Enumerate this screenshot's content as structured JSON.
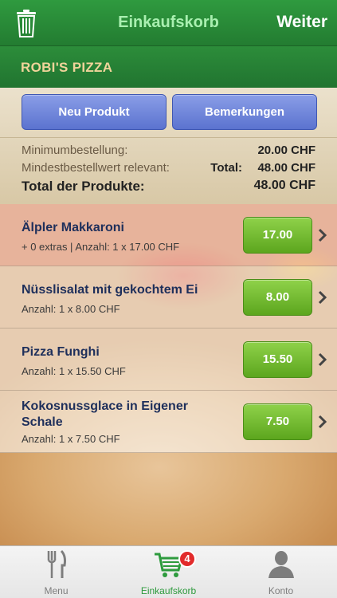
{
  "header": {
    "title": "Einkaufskorb",
    "right_action": "Weiter",
    "left_icon": "trash-icon"
  },
  "shop": {
    "name": "ROBI'S PIZZA"
  },
  "actions": {
    "new_product": "Neu Produkt",
    "remarks": "Bemerkungen"
  },
  "summary": {
    "min_order_label": "Minimumbestellung:",
    "min_order_value": "20.00 CHF",
    "min_relevant_label": "Mindestbestellwert relevant:",
    "total_label": "Total:",
    "total_value": "48.00 CHF",
    "products_total_label": "Total der Produkte:",
    "products_total_value": "48.00 CHF"
  },
  "items": [
    {
      "name": "Älpler Makkaroni",
      "desc": "+ 0 extras | Anzahl: 1 x 17.00 CHF",
      "price": "17.00"
    },
    {
      "name": "Nüsslisalat mit gekochtem Ei",
      "desc": "Anzahl: 1 x 8.00 CHF",
      "price": "8.00"
    },
    {
      "name": "Pizza Funghi",
      "desc": "Anzahl: 1 x 15.50 CHF",
      "price": "15.50"
    },
    {
      "name": "Kokosnussglace in Eigener Schale",
      "desc": "Anzahl: 1 x 7.50 CHF",
      "price": "7.50"
    }
  ],
  "tabs": [
    {
      "label": "Menu",
      "icon": "fork-knife-icon"
    },
    {
      "label": "Einkaufskorb",
      "icon": "cart-icon",
      "badge": "4"
    },
    {
      "label": "Konto",
      "icon": "person-icon"
    }
  ],
  "colors": {
    "header_green": "#2f9a3f",
    "accent_green": "#2e9b3e",
    "button_blue": "#5b73cf",
    "price_green": "#5ca61e",
    "badge_red": "#e22b2b"
  }
}
